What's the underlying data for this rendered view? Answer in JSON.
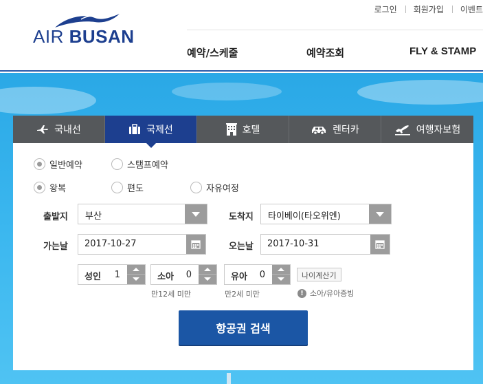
{
  "brand": {
    "air": "AIR",
    "busan": "BUSAN",
    "primary_color": "#1d3f8f"
  },
  "util_links": [
    "로그인",
    "회원가입",
    "이벤트"
  ],
  "main_nav": [
    "예약/스케줄",
    "예약조회",
    "FLY & STAMP"
  ],
  "tabs": [
    {
      "label": "국내선",
      "icon": "airplane-icon",
      "active": false
    },
    {
      "label": "국제선",
      "icon": "briefcase-icon",
      "active": true
    },
    {
      "label": "호텔",
      "icon": "hotel-icon",
      "active": false
    },
    {
      "label": "렌터카",
      "icon": "car-icon",
      "active": false
    },
    {
      "label": "여행자보험",
      "icon": "plane-takeoff-icon",
      "active": false
    }
  ],
  "booking_type": {
    "options": [
      "일반예약",
      "스탬프예약"
    ],
    "selected": "일반예약"
  },
  "trip_type": {
    "options": [
      "왕복",
      "편도",
      "자유여정"
    ],
    "selected": "왕복"
  },
  "departure": {
    "label": "출발지",
    "value": "부산"
  },
  "arrival": {
    "label": "도착지",
    "value": "타이베이(타오위엔)"
  },
  "depart_date": {
    "label": "가는날",
    "value": "2017-10-27"
  },
  "return_date": {
    "label": "오는날",
    "value": "2017-10-31"
  },
  "passengers": {
    "adult": {
      "label": "성인",
      "value": "1"
    },
    "child": {
      "label": "소아",
      "value": "0",
      "hint": "만12세 미만"
    },
    "infant": {
      "label": "유아",
      "value": "0",
      "hint": "만2세 미만"
    }
  },
  "age_calc_label": "나이계산기",
  "proof_label": "소아/유아증빙",
  "search_label": "항공권 검색"
}
